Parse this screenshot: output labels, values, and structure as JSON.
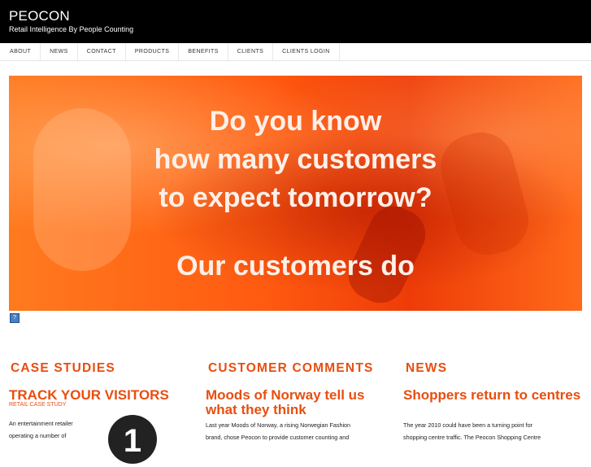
{
  "site": {
    "brand": "PEOCON",
    "tagline": "Retail Intelligence By People Counting"
  },
  "nav": {
    "items": [
      {
        "label": "ABOUT"
      },
      {
        "label": "NEWS"
      },
      {
        "label": "CONTACT"
      },
      {
        "label": "PRODUCTS"
      },
      {
        "label": "BENEFITS"
      },
      {
        "label": "CLIENTS"
      },
      {
        "label": "CLIENTS LOGIN"
      }
    ]
  },
  "hero": {
    "line1": "Do you know",
    "line2": "how many customers",
    "line3": "to expect tomorrow?",
    "line4": "Our customers do"
  },
  "case_studies": {
    "heading": "CASE STUDIES",
    "title": "TRACK YOUR VISITORS",
    "kicker": "RETAIL CASE STUDY",
    "body": "An entertainment retailer operating a number of",
    "badge": "1"
  },
  "customer_comments": {
    "heading": "CUSTOMER COMMENTS",
    "title": "Moods of Norway tell us what they think",
    "body": "Last year Moods of Norway, a rising Norwegian Fashion brand, chose Peocon to provide customer counting and"
  },
  "news": {
    "heading": "NEWS",
    "title": "Shoppers return to centres",
    "body": "The year 2010 could have been a turning point for shopping centre traffic. The Peocon Shopping Centre"
  },
  "colors": {
    "accent": "#e84e10",
    "topbar": "#000000",
    "hero": "#ff5a10"
  }
}
